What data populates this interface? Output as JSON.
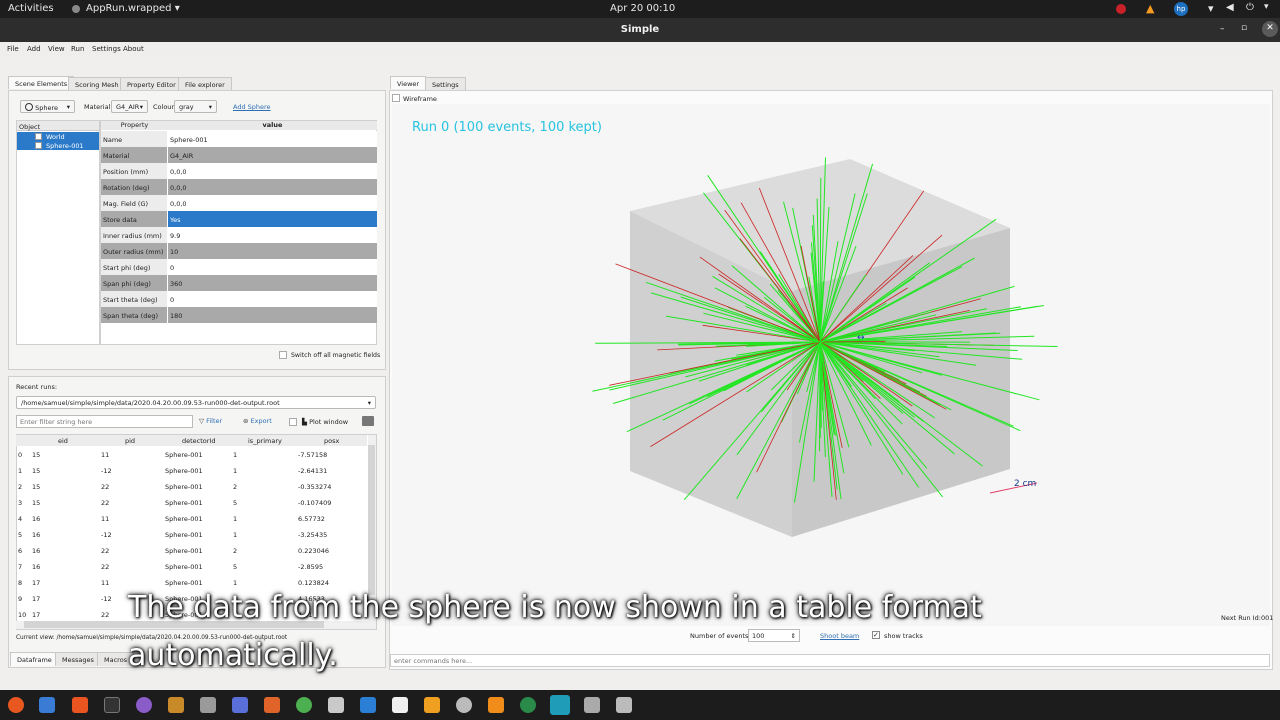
{
  "topbar": {
    "activities": "Activities",
    "app_name": "AppRun.wrapped",
    "clock": "Apr 20  00:10"
  },
  "window": {
    "title": "Simple"
  },
  "menu": [
    "File",
    "Add",
    "View",
    "Run",
    "Settings",
    "About"
  ],
  "left_tabs": [
    "Scene Elements",
    "Scoring Mesh",
    "Property Editor",
    "File explorer"
  ],
  "scene": {
    "shape_select": "Sphere",
    "material_label": "Material",
    "material_value": "G4_AIR",
    "colour_label": "Colour",
    "colour_value": "gray",
    "add_label": "Add Sphere",
    "object_header": "Object",
    "objects": [
      "World",
      "Sphere-001"
    ],
    "property_header": "Property",
    "value_header": "value",
    "properties": [
      {
        "k": "Name",
        "v": "Sphere-001"
      },
      {
        "k": "Material",
        "v": "G4_AIR"
      },
      {
        "k": "Position (mm)",
        "v": "0,0,0"
      },
      {
        "k": "Rotation (deg)",
        "v": "0,0,0"
      },
      {
        "k": "Mag. Field (G)",
        "v": "0,0,0"
      },
      {
        "k": "Store data",
        "v": "Yes"
      },
      {
        "k": "Inner radius (mm)",
        "v": "9.9"
      },
      {
        "k": "Outer radius (mm)",
        "v": "10"
      },
      {
        "k": "Start phi (deg)",
        "v": "0"
      },
      {
        "k": "Span phi (deg)",
        "v": "360"
      },
      {
        "k": "Start theta (deg)",
        "v": "0"
      },
      {
        "k": "Span theta (deg)",
        "v": "180"
      }
    ],
    "switch_off_label": "Switch off all magnetic fields"
  },
  "runs": {
    "recent_label": "Recent runs:",
    "path": "/home/samuel/simple/simple/data/2020.04.20.00.09.53-run000-det-output.root",
    "filter_placeholder": "Enter filter string here",
    "filter_label": "Filter",
    "export_label": "Export",
    "plot_window_label": "Plot window",
    "columns": [
      "eid",
      "pid",
      "detectorId",
      "is_primary",
      "posx"
    ],
    "rows": [
      [
        "0",
        "15",
        "11",
        "Sphere-001",
        "1",
        "-7.57158"
      ],
      [
        "1",
        "15",
        "-12",
        "Sphere-001",
        "1",
        "-2.64131"
      ],
      [
        "2",
        "15",
        "22",
        "Sphere-001",
        "2",
        "-0.353274"
      ],
      [
        "3",
        "15",
        "22",
        "Sphere-001",
        "5",
        "-0.107409"
      ],
      [
        "4",
        "16",
        "11",
        "Sphere-001",
        "1",
        "6.57732"
      ],
      [
        "5",
        "16",
        "-12",
        "Sphere-001",
        "1",
        "-3.25435"
      ],
      [
        "6",
        "16",
        "22",
        "Sphere-001",
        "2",
        "0.223046"
      ],
      [
        "7",
        "16",
        "22",
        "Sphere-001",
        "5",
        "-2.8595"
      ],
      [
        "8",
        "17",
        "11",
        "Sphere-001",
        "1",
        "0.123824"
      ],
      [
        "9",
        "17",
        "-12",
        "Sphere-001",
        "1",
        "4.16533"
      ],
      [
        "10",
        "17",
        "22",
        "Sphere-001",
        "",
        "4.91"
      ]
    ],
    "current_view": "Current view: /home/samuel/simple/simple/data/2020.04.20.00.09.53-run000-det-output.root"
  },
  "bottom_tabs": [
    "Dataframe",
    "Messages",
    "Macros"
  ],
  "viewer": {
    "tabs": [
      "Viewer",
      "Settings"
    ],
    "wireframe_label": "Wireframe",
    "run_label": "Run 0 (100 events, 100 kept)",
    "scale_label": "2 cm",
    "next_run": "Next Run Id:001",
    "number_of_events_label": "Number of events",
    "number_of_events_value": "100",
    "shoot_label": "Shoot beam",
    "show_tracks_label": "show tracks",
    "command_placeholder": "enter commands here..."
  },
  "subtitle": {
    "line1": "The data from the sphere is now shown in a table format",
    "line2": "automatically."
  },
  "colors": {
    "accent": "#2b7ac9",
    "track_green": "#22e622",
    "track_red": "#cc2222",
    "run_label": "#27c3e0"
  }
}
